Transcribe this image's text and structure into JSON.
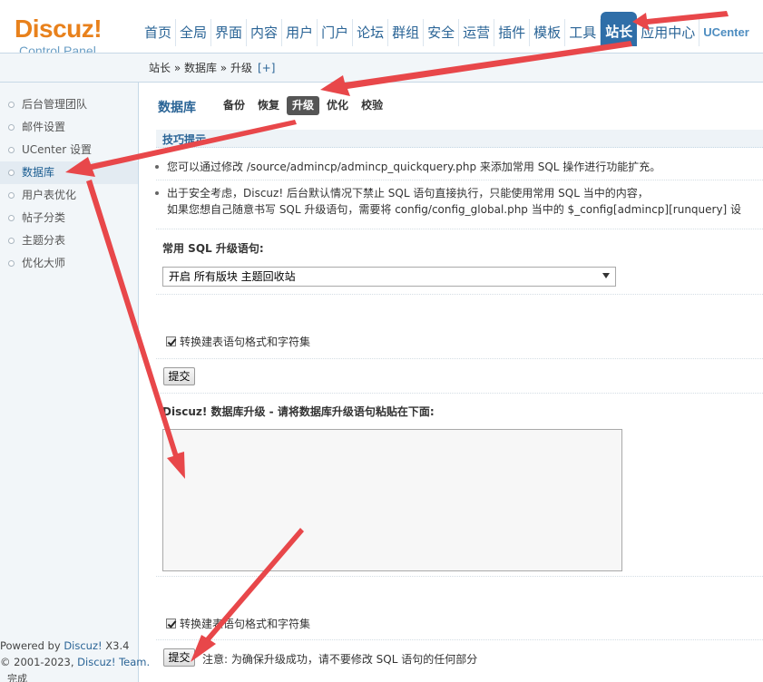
{
  "brand": {
    "name": "Discuz!",
    "subtitle": "Control Panel"
  },
  "topnav": {
    "items": [
      "首页",
      "全局",
      "界面",
      "内容",
      "用户",
      "门户",
      "论坛",
      "群组",
      "安全",
      "运营",
      "插件",
      "模板",
      "工具",
      "站长",
      "应用中心",
      "UCenter"
    ],
    "active": "站长"
  },
  "breadcrumb": {
    "text": "站长 » 数据库 » 升级",
    "plus": "[+]"
  },
  "sidebar": {
    "items": [
      "后台管理团队",
      "邮件设置",
      "UCenter 设置",
      "数据库",
      "用户表优化",
      "帖子分类",
      "主题分表",
      "优化大师"
    ],
    "active": "数据库"
  },
  "page": {
    "title": "数据库",
    "tabs": [
      "备份",
      "恢复",
      "升级",
      "优化",
      "校验"
    ],
    "active_tab": "升级"
  },
  "tips": {
    "header": "技巧提示",
    "line1": "您可以通过修改 /source/admincp/admincp_quickquery.php 来添加常用 SQL 操作进行功能扩充。",
    "line2": "出于安全考虑，Discuz! 后台默认情况下禁止 SQL 语句直接执行，只能使用常用 SQL 当中的内容，",
    "line3": "如果您想自己随意书写 SQL 升级语句，需要将 config/config_global.php 当中的 $_config[admincp][runquery] 设"
  },
  "common_sql": {
    "label": "常用 SQL 升级语句:",
    "selected": "开启 所有版块 主题回收站"
  },
  "form1": {
    "checkbox_label": "转换建表语句格式和字符集",
    "submit": "提交"
  },
  "form2": {
    "label": "Discuz! 数据库升级 - 请将数据库升级语句粘贴在下面:",
    "checkbox_label": "转换建表语句格式和字符集",
    "submit": "提交",
    "note": "注意: 为确保升级成功，请不要修改 SQL 语句的任何部分"
  },
  "footer": {
    "powered_prefix": "Powered by ",
    "powered_link": "Discuz!",
    "version": " X3.4",
    "copyright_prefix": "© 2001-2023, ",
    "copyright_link": "Discuz! Team."
  },
  "statusbar": {
    "text": "完成"
  },
  "colors": {
    "accent": "#2f6ea8",
    "logo": "#e8811c",
    "annotation": "#e8474a"
  }
}
